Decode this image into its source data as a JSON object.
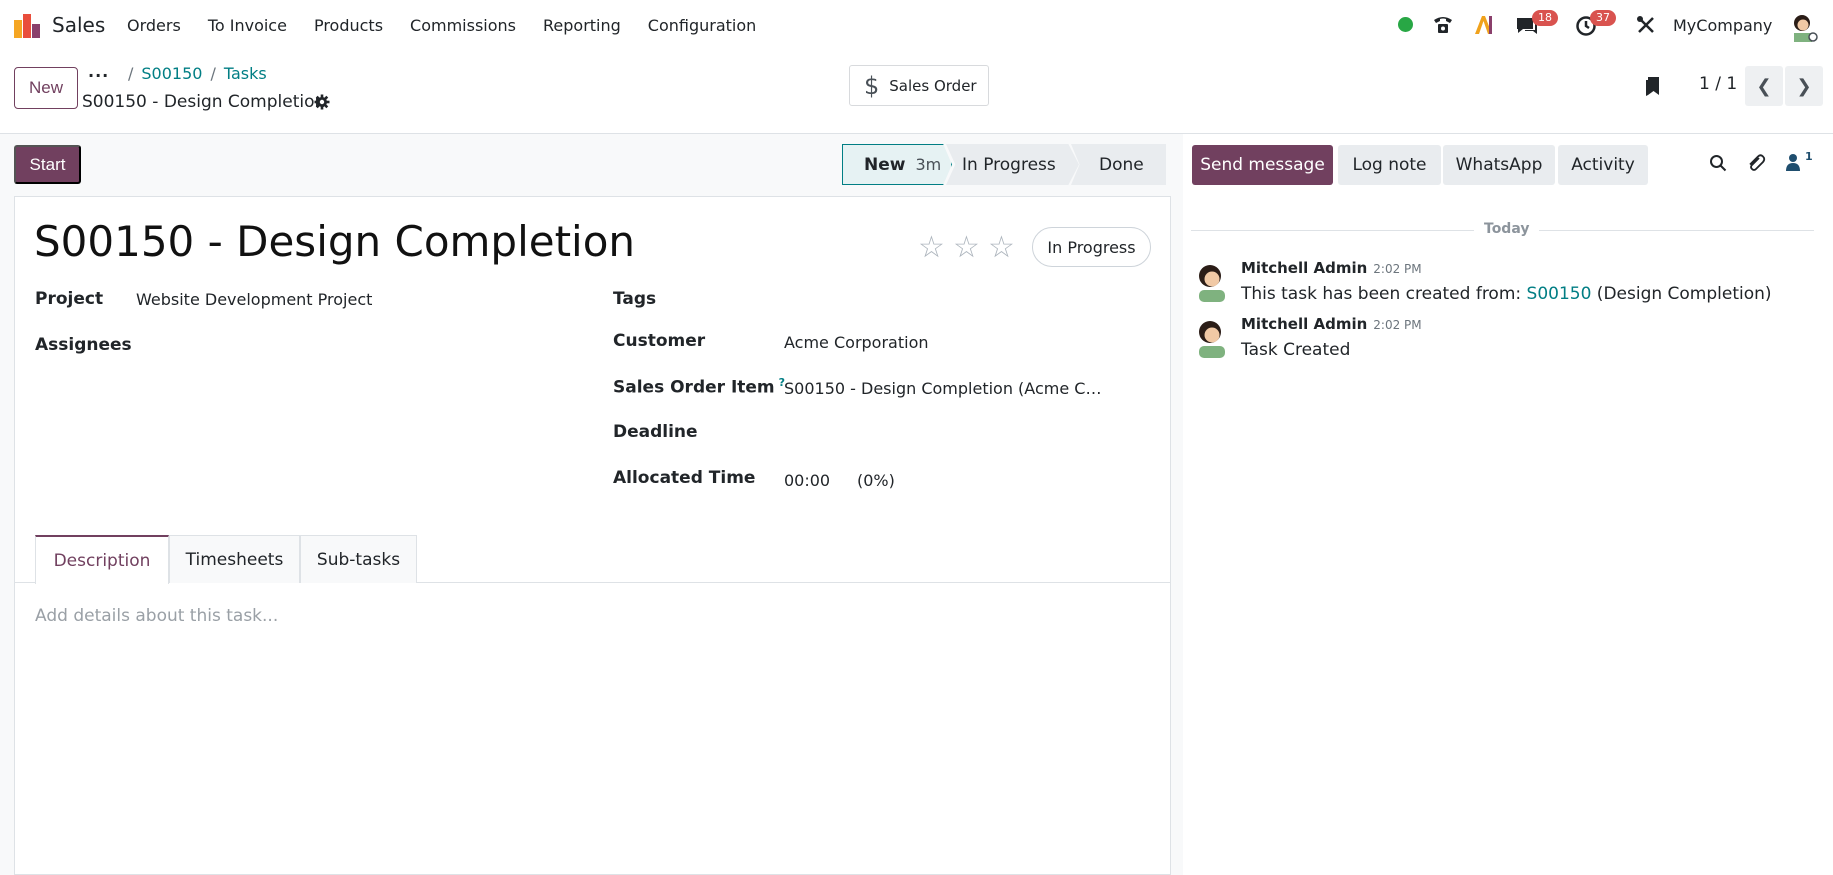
{
  "navbar": {
    "app_name": "Sales",
    "menu": [
      "Orders",
      "To Invoice",
      "Products",
      "Commissions",
      "Reporting",
      "Configuration"
    ],
    "messages_badge": "18",
    "activities_badge": "37",
    "company": "MyCompany"
  },
  "control": {
    "new_label": "New",
    "breadcrumb_more": "...",
    "breadcrumb": [
      "S00150",
      "Tasks"
    ],
    "record_title": "S00150 - Design Completion",
    "smart_button": "Sales Order",
    "pager": "1 / 1"
  },
  "statusbar": {
    "start_label": "Start",
    "stages": [
      {
        "label": "New",
        "duration": "3m"
      },
      {
        "label": "In Progress"
      },
      {
        "label": "Done"
      }
    ]
  },
  "form": {
    "title": "S00150 - Design Completion",
    "status_pill": "In Progress",
    "fields_left": {
      "project_label": "Project",
      "project_value": "Website Development Project",
      "assignees_label": "Assignees"
    },
    "fields_right": {
      "tags_label": "Tags",
      "customer_label": "Customer",
      "customer_value": "Acme Corporation",
      "soi_label": "Sales Order Item",
      "soi_help": "?",
      "soi_value": "S00150 - Design Completion (Acme C…",
      "deadline_label": "Deadline",
      "allocated_label": "Allocated Time",
      "allocated_value": "00:00",
      "allocated_pct": "(0%)"
    },
    "tabs": [
      "Description",
      "Timesheets",
      "Sub-tasks"
    ],
    "description_placeholder": "Add details about this task..."
  },
  "chatter": {
    "buttons": {
      "send": "Send message",
      "log": "Log note",
      "whatsapp": "WhatsApp",
      "activity": "Activity"
    },
    "followers_count": "1",
    "date_separator": "Today",
    "messages": [
      {
        "author": "Mitchell Admin",
        "time": "2:02 PM",
        "text_before": "This task has been created from: ",
        "link": "S00150",
        "text_after": " (Design Completion)"
      },
      {
        "author": "Mitchell Admin",
        "time": "2:02 PM",
        "text": "Task Created"
      }
    ]
  },
  "colors": {
    "primary": "#71405f",
    "link": "#017e84",
    "online": "#28a745",
    "badge": "#d9534f"
  }
}
